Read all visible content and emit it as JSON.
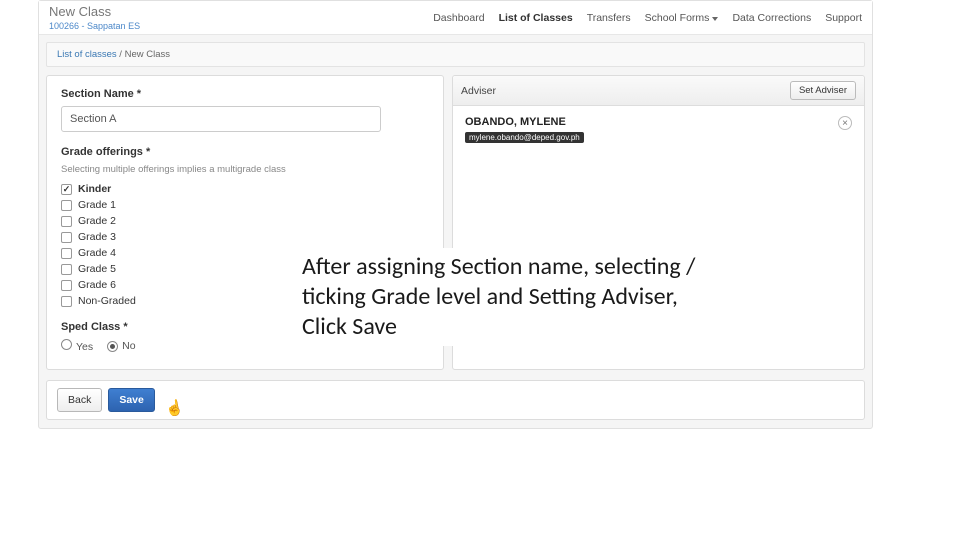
{
  "brand": {
    "title": "New Class",
    "sub": "100266 - Sappatan ES"
  },
  "nav": {
    "items": [
      {
        "label": "Dashboard",
        "name": "nav-dashboard"
      },
      {
        "label": "List of Classes",
        "name": "nav-classes"
      },
      {
        "label": "Transfers",
        "name": "nav-transfers"
      },
      {
        "label": "School Forms",
        "name": "nav-school-forms",
        "dropdown": true
      },
      {
        "label": "Data Corrections",
        "name": "nav-data-corrections"
      },
      {
        "label": "Support",
        "name": "nav-support"
      }
    ]
  },
  "breadcrumb": {
    "link": "List of classes",
    "sep": " / ",
    "current": "New Class"
  },
  "form": {
    "section_name_label": "Section Name *",
    "section_name_value": "Section A",
    "grade_offerings_label": "Grade offerings *",
    "grade_offerings_hint": "Selecting multiple offerings implies a multigrade class",
    "grades": [
      {
        "label": "Kinder",
        "checked": true
      },
      {
        "label": "Grade 1",
        "checked": false
      },
      {
        "label": "Grade 2",
        "checked": false
      },
      {
        "label": "Grade 3",
        "checked": false
      },
      {
        "label": "Grade 4",
        "checked": false
      },
      {
        "label": "Grade 5",
        "checked": false
      },
      {
        "label": "Grade 6",
        "checked": false
      },
      {
        "label": "Non-Graded",
        "checked": false
      }
    ],
    "sped_label": "Sped Class *",
    "sped_yes": "Yes",
    "sped_no": "No",
    "sped_value": "No"
  },
  "adviser": {
    "panel_label": "Adviser",
    "set_button": "Set Adviser",
    "name": "OBANDO, MYLENE",
    "email": "mylene.obando@deped.gov.ph"
  },
  "footer": {
    "back": "Back",
    "save": "Save"
  },
  "instruction_text": "After assigning Section name, selecting / ticking Grade level and Setting Adviser, Click Save"
}
